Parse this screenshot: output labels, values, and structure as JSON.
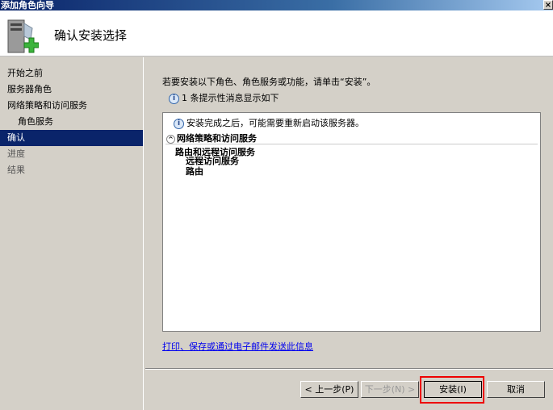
{
  "window": {
    "title": "添加角色向导",
    "close": "×"
  },
  "header": {
    "title": "确认安装选择"
  },
  "sidebar": {
    "items": [
      {
        "label": "开始之前",
        "state": "normal"
      },
      {
        "label": "服务器角色",
        "state": "normal"
      },
      {
        "label": "网络策略和访问服务",
        "state": "normal"
      },
      {
        "label": "角色服务",
        "state": "sub"
      },
      {
        "label": "确认",
        "state": "active"
      },
      {
        "label": "进度",
        "state": "dim"
      },
      {
        "label": "结果",
        "state": "dim"
      }
    ]
  },
  "main": {
    "intro": "若要安装以下角色、角色服务或功能，请单击“安装”。",
    "note": "1 条提示性消息显示如下",
    "restart_msg": "安装完成之后，可能需要重新启动该服务器。",
    "section": "网络策略和访问服务",
    "services": [
      "路由和远程访问服务",
      "远程访问服务",
      "路由"
    ],
    "link": "打印、保存或通过电子邮件发送此信息"
  },
  "buttons": {
    "prev": "< 上一步(P)",
    "next": "下一步(N) >",
    "install": "安装(I)",
    "cancel": "取消"
  }
}
